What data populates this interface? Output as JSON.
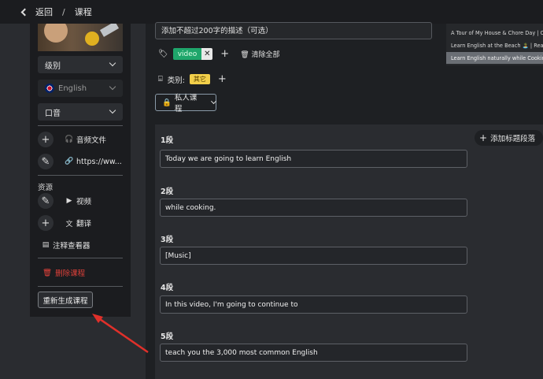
{
  "topbar": {
    "back_label": "返回",
    "separator": "/",
    "page_title": "课程"
  },
  "sidebar": {
    "level_label": "级别",
    "language_label": "English",
    "accent_label": "口音",
    "audio_file_label": "音频文件",
    "link_label": "https://ww...",
    "resources_label": "资源",
    "video_label": "视频",
    "translate_label": "翻译",
    "annotation_viewer_label": "注释查看器",
    "delete_label": "删除课程",
    "regenerate_label": "重新生成课程"
  },
  "main": {
    "description_placeholder": "添加不超过200字的描述（可选）",
    "tags": [
      "video"
    ],
    "clear_all_label": "清除全部",
    "category_label": "类别:",
    "category_badge": "其它",
    "privacy_button": "私人课程",
    "add_paragraph_label": "添加标题段落",
    "segments": [
      {
        "label": "1段",
        "text": "Today we are going to learn English"
      },
      {
        "label": "2段",
        "text": "while cooking."
      },
      {
        "label": "3段",
        "text": "[Music]"
      },
      {
        "label": "4段",
        "text": "In this video, I'm going to continue to"
      },
      {
        "label": "5段",
        "text": "teach you the 3,000 most common English"
      }
    ]
  },
  "dropdown": {
    "items": [
      "A Tour of My House & Chore Day | Comp",
      "Learn English at the Beach 🏝️ | Real Ph",
      "Learn English naturally while Cooking 🍳 | Lea"
    ],
    "active_index": 2
  },
  "colors": {
    "danger": "#e0413a",
    "tag_green": "#1fa66b",
    "badge_yellow": "#f2cf4a",
    "annotation_arrow": "#e0302a"
  }
}
